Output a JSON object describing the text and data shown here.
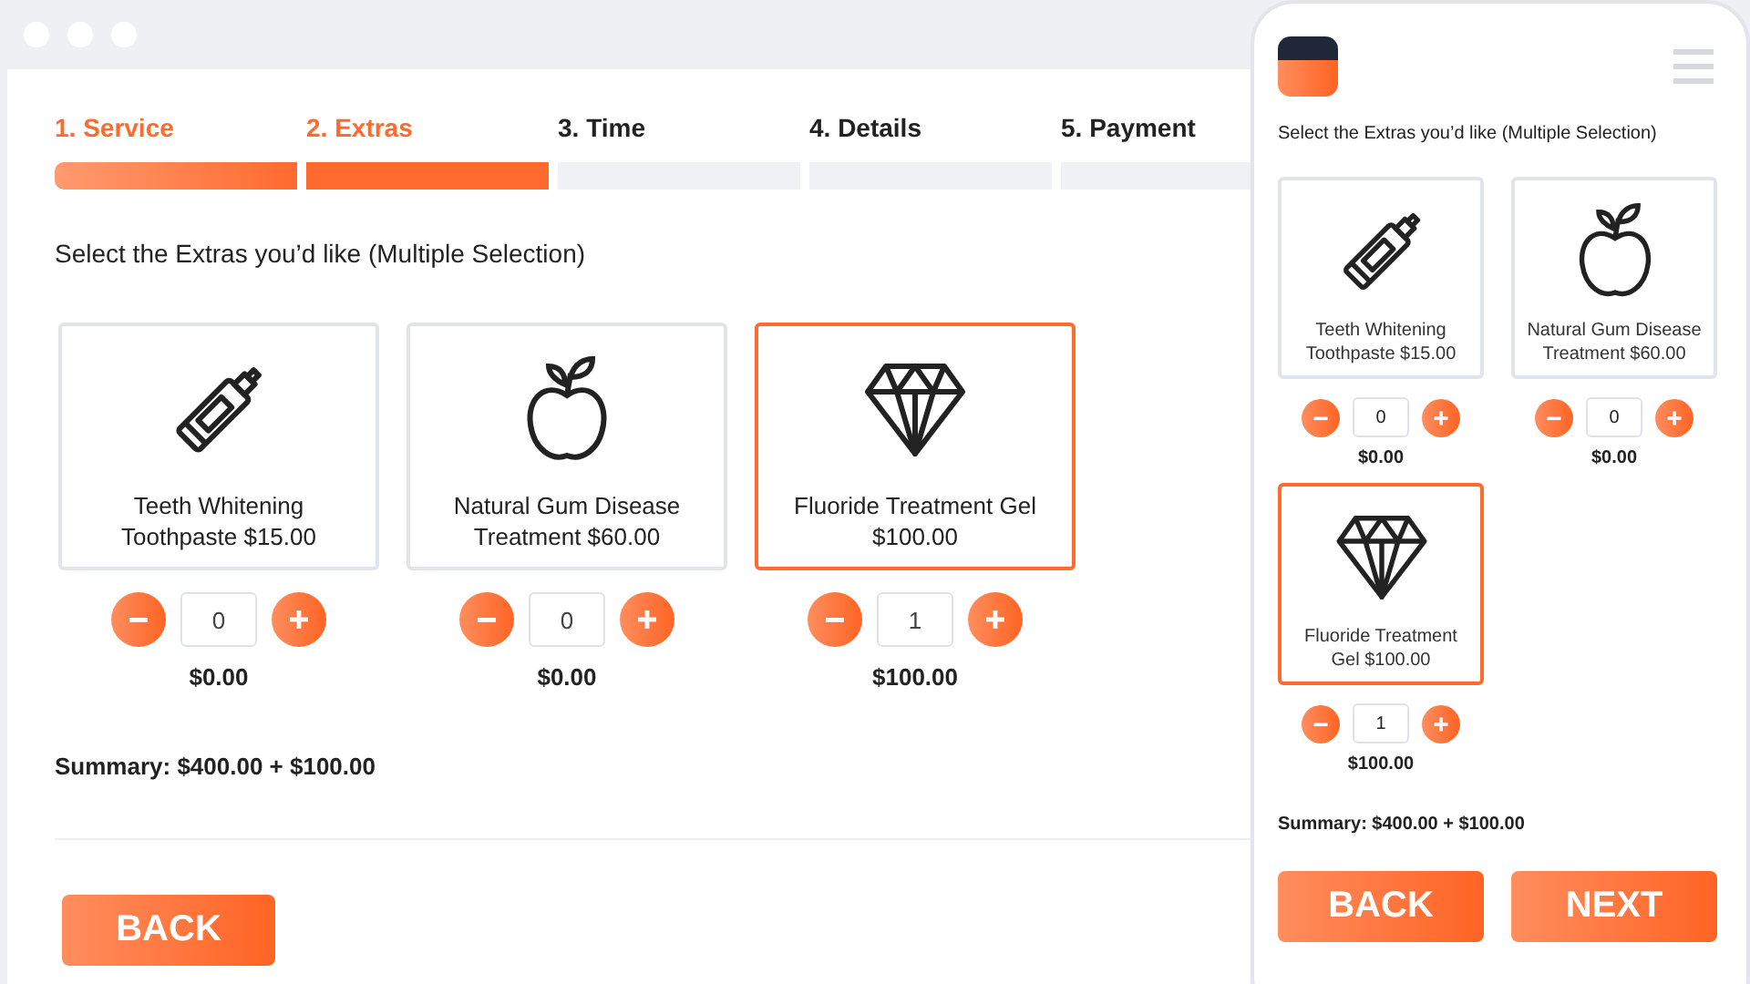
{
  "steps": [
    {
      "label": "1. Service",
      "completed": true
    },
    {
      "label": "2. Extras",
      "completed": true
    },
    {
      "label": "3. Time",
      "completed": false
    },
    {
      "label": "4. Details",
      "completed": false
    },
    {
      "label": "5. Payment",
      "completed": false
    }
  ],
  "desktop": {
    "instruction": "Select the Extras you’d like (Multiple Selection)",
    "extras": [
      {
        "name": "Teeth Whitening Toothpaste $15.00",
        "quantity": "0",
        "subtotal": "$0.00",
        "selected": false
      },
      {
        "name": "Natural Gum Disease Treatment $60.00",
        "quantity": "0",
        "subtotal": "$0.00",
        "selected": false
      },
      {
        "name": "Fluoride Treatment Gel $100.00",
        "quantity": "1",
        "subtotal": "$100.00",
        "selected": true
      }
    ],
    "summary": "Summary: $400.00 + $100.00",
    "buttons": [
      "BACK"
    ]
  },
  "mobile": {
    "instruction": "Select the Extras you’d like (Multiple Selection)",
    "extras": [
      {
        "name": "Teeth Whitening Toothpaste $15.00",
        "quantity": "0",
        "subtotal": "$0.00",
        "selected": false
      },
      {
        "name": "Natural Gum Disease Treatment $60.00",
        "quantity": "0",
        "subtotal": "$0.00",
        "selected": false
      },
      {
        "name": "Fluoride Treatment Gel $100.00",
        "quantity": "1",
        "subtotal": "$100.00",
        "selected": true
      }
    ],
    "summary": "Summary: $400.00 + $100.00",
    "buttons": [
      "BACK",
      "NEXT"
    ]
  }
}
